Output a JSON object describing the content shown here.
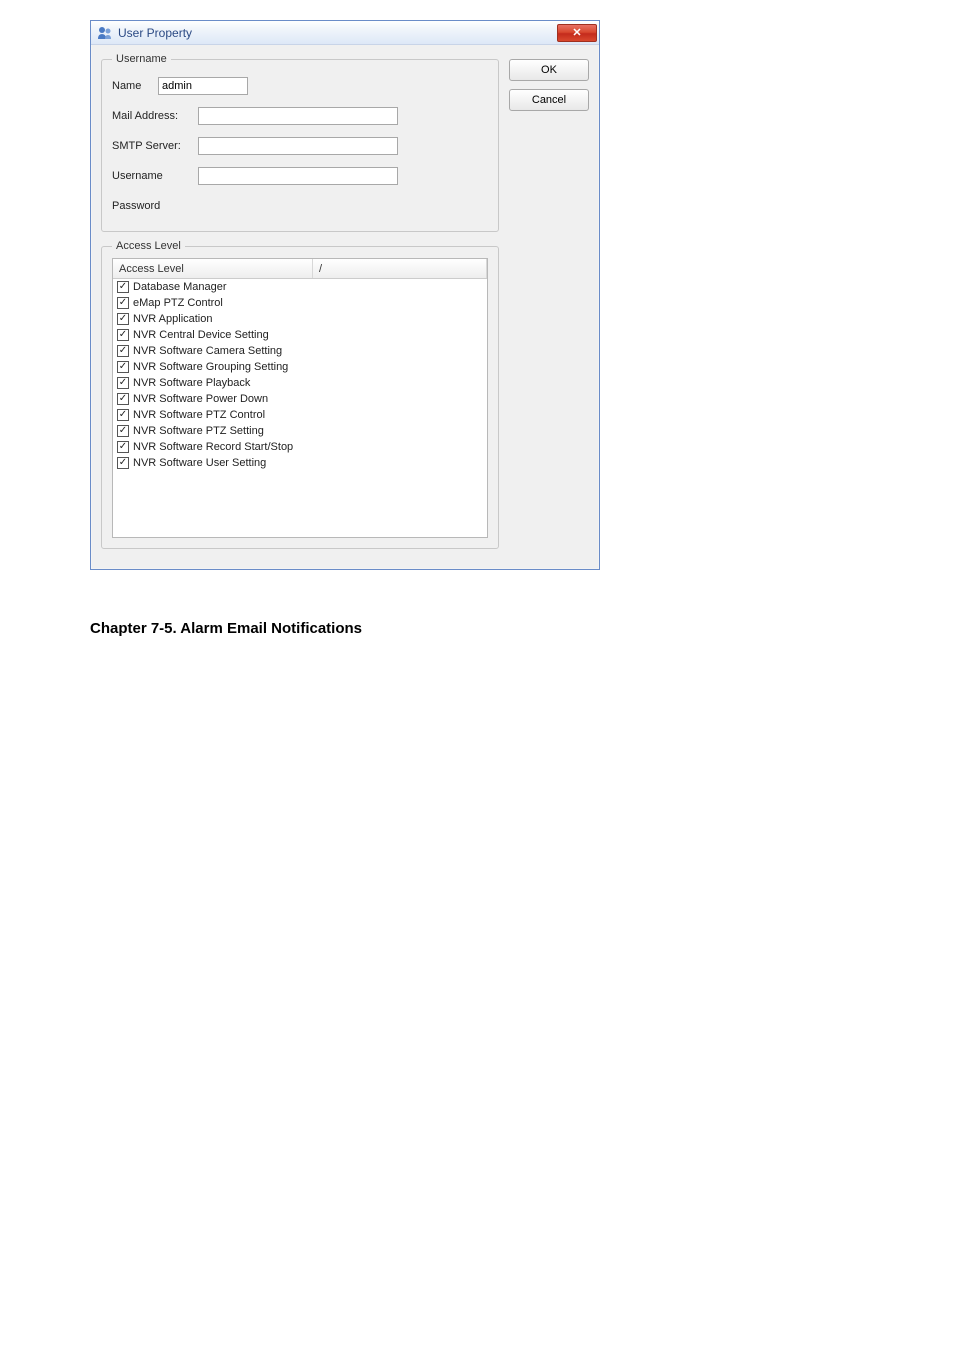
{
  "dialog": {
    "title": "User Property",
    "close_glyph": "✕",
    "username_group": {
      "legend": "Username",
      "name_label": "Name",
      "name_value": "admin",
      "mail_label": "Mail Address:",
      "mail_value": "",
      "smtp_label": "SMTP Server:",
      "smtp_value": "",
      "user_label": "Username",
      "user_value": "",
      "pass_label": "Password",
      "pass_value": ""
    },
    "access_group": {
      "legend": "Access Level",
      "header_col1": "Access Level",
      "header_col2": "/",
      "items": [
        "Database Manager",
        "eMap PTZ Control",
        "NVR Application",
        "NVR Central Device Setting",
        "NVR Software Camera Setting",
        "NVR Software Grouping Setting",
        "NVR Software Playback",
        "NVR Software Power Down",
        "NVR Software PTZ Control",
        "NVR Software PTZ Setting",
        "NVR Software Record Start/Stop",
        "NVR Software User Setting"
      ]
    },
    "buttons": {
      "ok": "OK",
      "cancel": "Cancel"
    }
  },
  "chapter": "Chapter 7-5.   Alarm Email Notifications"
}
